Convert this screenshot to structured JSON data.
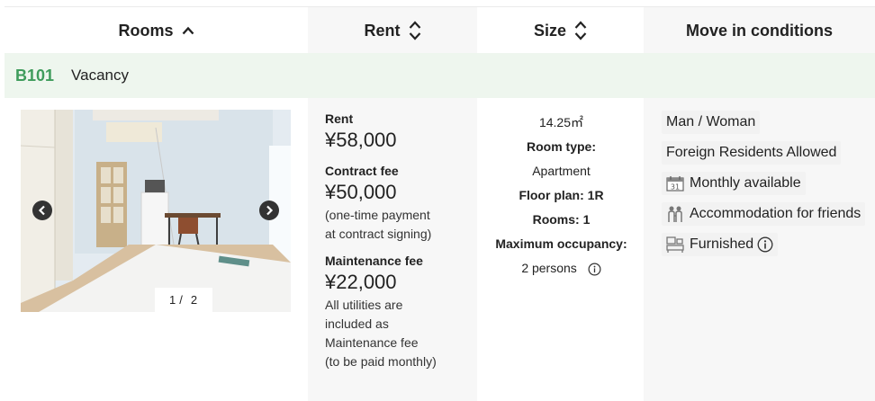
{
  "header": {
    "rooms": "Rooms",
    "rent": "Rent",
    "size": "Size",
    "conditions": "Move in conditions"
  },
  "room": {
    "number": "B101",
    "status": "Vacancy",
    "pager": {
      "current": "1",
      "separator": "/",
      "total": "2"
    }
  },
  "rent": {
    "rent_label": "Rent",
    "rent_value": "¥58,000",
    "contract_label": "Contract fee",
    "contract_value": "¥50,000",
    "contract_note_1": "(one-time payment",
    "contract_note_2": "at contract signing)",
    "maint_label": "Maintenance fee",
    "maint_value": "¥22,000",
    "maint_note_1": "All utilities are",
    "maint_note_2": "included as",
    "maint_note_3": "Maintenance fee",
    "maint_note_4": "(to be paid monthly)"
  },
  "size": {
    "area": "14.25㎡",
    "room_type_label": "Room type:",
    "room_type_value": "Apartment",
    "floor_plan": "Floor plan: 1R",
    "rooms": "Rooms: 1",
    "max_occ_label": "Maximum occupancy:",
    "max_occ_value": "2 persons"
  },
  "conditions": {
    "tags": [
      {
        "label": "Man / Woman",
        "icon": null
      },
      {
        "label": "Foreign Residents Allowed",
        "icon": null
      },
      {
        "label": "Monthly available",
        "icon": "calendar-icon"
      },
      {
        "label": "Accommodation for friends",
        "icon": "people-icon"
      },
      {
        "label": "Furnished",
        "icon": "furniture-icon"
      }
    ]
  },
  "colors": {
    "accent_green": "#3f9c5c",
    "vacancy_bg": "#eef6ee",
    "column_shade": "#f7f7f7",
    "tag_bg": "#f2f2f2"
  }
}
